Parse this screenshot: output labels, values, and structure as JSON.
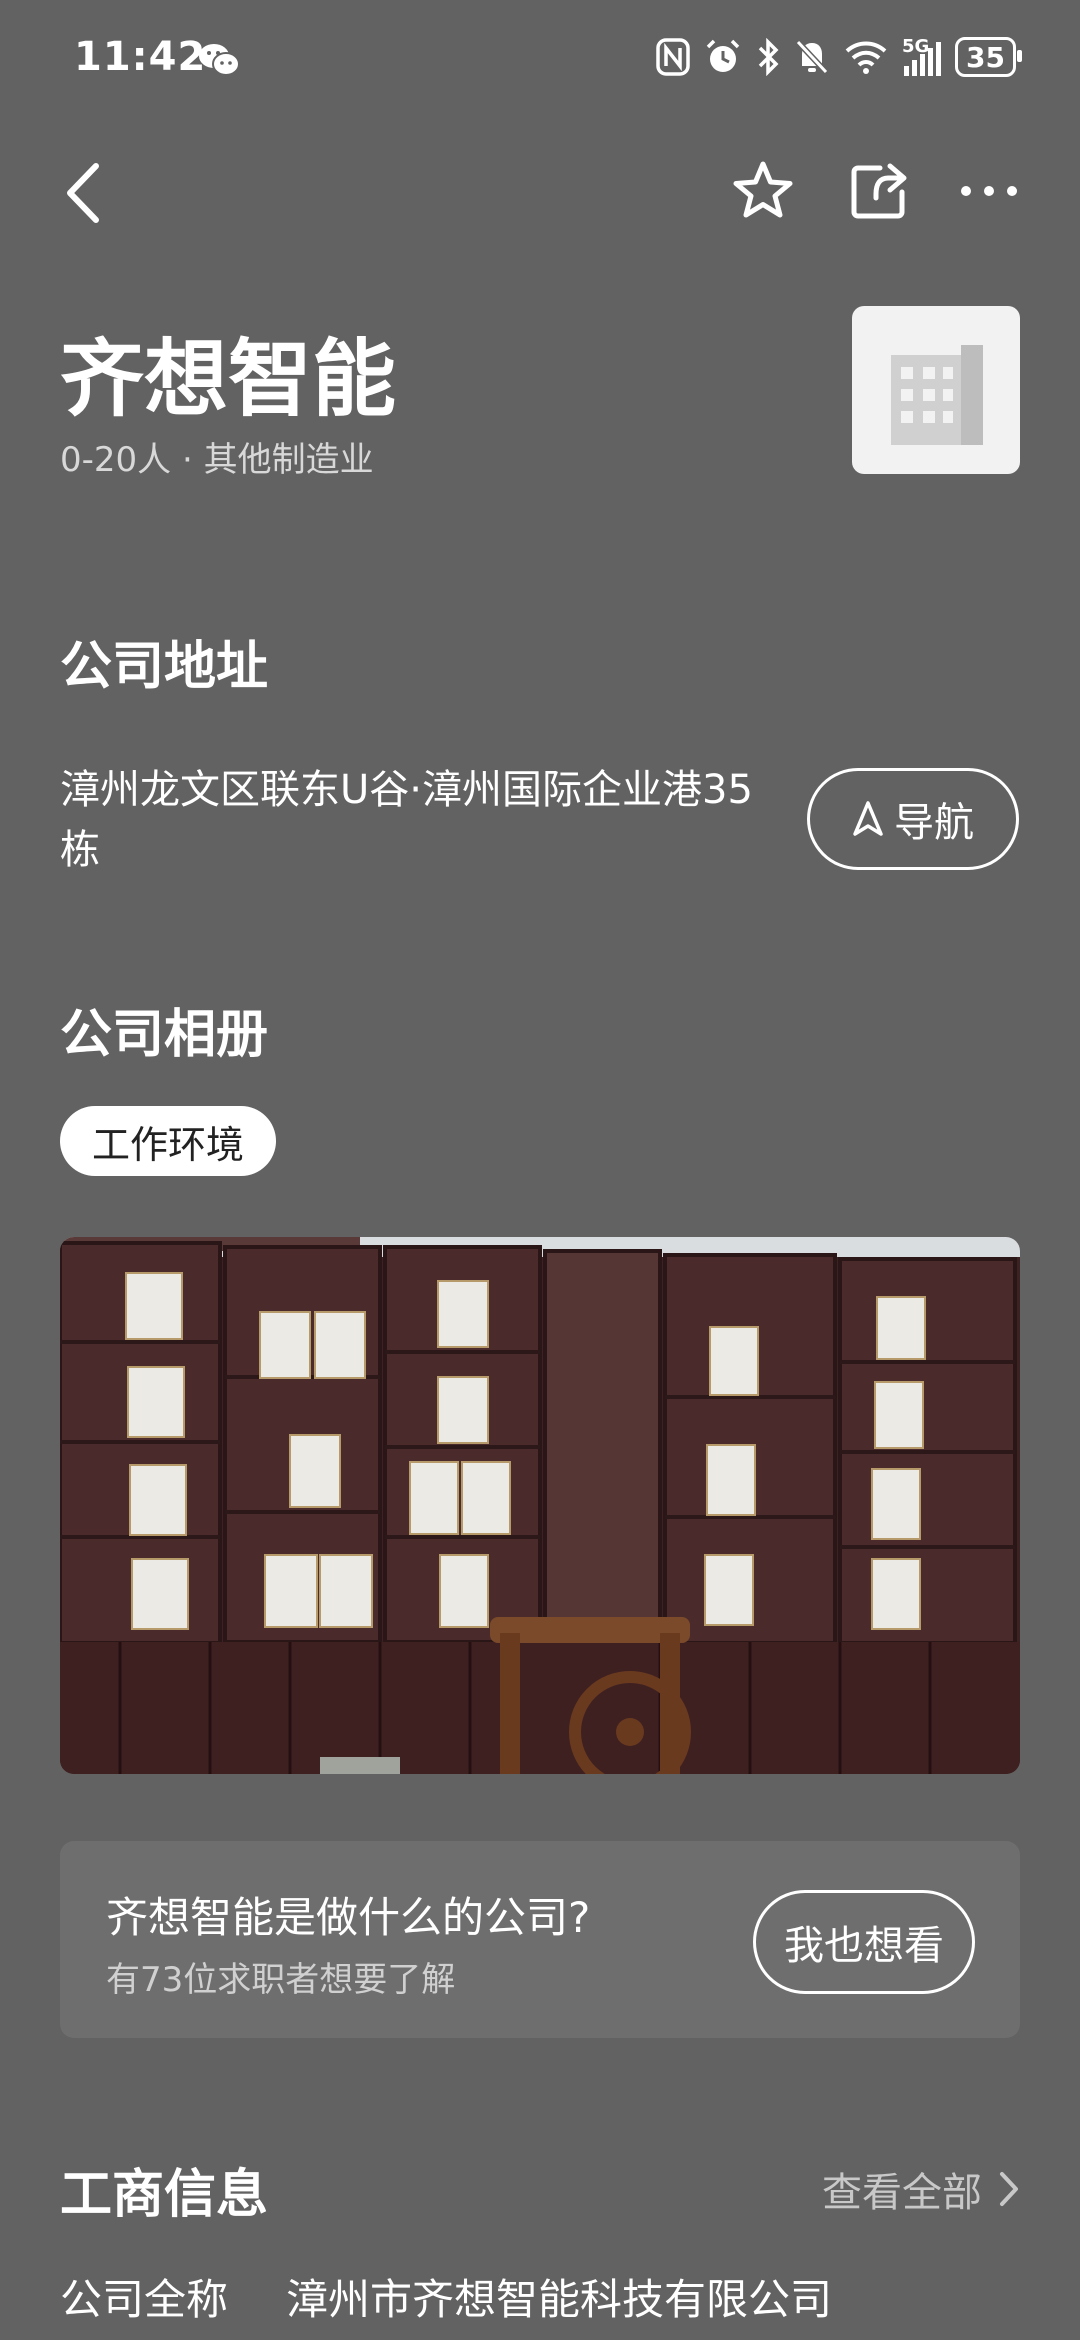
{
  "status_bar": {
    "time": "11:42",
    "network": "5G",
    "battery": "35",
    "icons": [
      "wechat-icon",
      "nfc-icon",
      "alarm-icon",
      "bluetooth-icon",
      "mute-icon",
      "wifi-icon",
      "signal-icon",
      "battery-icon"
    ]
  },
  "nav": {
    "icons": [
      "back-icon",
      "star-icon",
      "share-icon",
      "more-icon"
    ]
  },
  "company": {
    "name": "齐想智能",
    "meta": "0-20人 · 其他制造业"
  },
  "address_section": {
    "heading": "公司地址",
    "address": "漳州龙文区联东U谷·漳州国际企业港35栋",
    "navigate_label": "导航"
  },
  "album_section": {
    "heading": "公司相册",
    "tag": "工作环境"
  },
  "prompt_card": {
    "question": "齐想智能是做什么的公司?",
    "subtext": "有73位求职者想要了解",
    "button_label": "我也想看"
  },
  "business_info": {
    "heading": "工商信息",
    "view_all": "查看全部",
    "full_name_label": "公司全称",
    "full_name_value": "漳州市齐想智能科技有限公司"
  },
  "colors": {
    "background": "#626262",
    "card": "#6e6e6e",
    "text": "#ffffff"
  }
}
